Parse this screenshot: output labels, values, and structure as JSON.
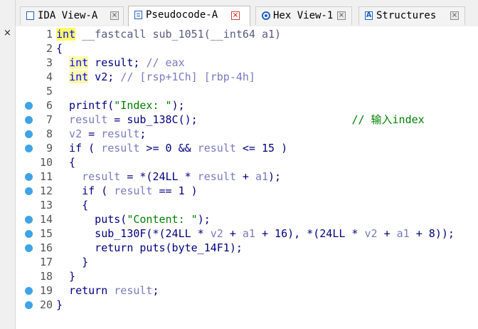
{
  "tabs": [
    {
      "label": "IDA View-A",
      "icon": "ida-view-icon"
    },
    {
      "label": "Pseudocode-A",
      "icon": "pseudocode-icon"
    },
    {
      "label": "Hex View-1",
      "icon": "hex-view-icon"
    },
    {
      "label": "Structures",
      "icon": "structures-icon"
    }
  ],
  "panel_close": "×",
  "tab_close": "×",
  "lines": [
    {
      "n": "1",
      "dot": false,
      "parts": [
        [
          "kwhl",
          "int"
        ],
        [
          "gry",
          " __fastcall sub_1051(__int64 a1)"
        ]
      ]
    },
    {
      "n": "2",
      "dot": false,
      "parts": [
        [
          "plain",
          "{"
        ]
      ]
    },
    {
      "n": "3",
      "dot": false,
      "parts": [
        [
          "plain",
          "  "
        ],
        [
          "kwhl2",
          "int"
        ],
        [
          "plain",
          " result; "
        ],
        [
          "var",
          "// eax"
        ]
      ]
    },
    {
      "n": "4",
      "dot": false,
      "parts": [
        [
          "plain",
          "  "
        ],
        [
          "kwhl2",
          "int"
        ],
        [
          "plain",
          " v2; "
        ],
        [
          "var",
          "// [rsp+1Ch] [rbp-4h]"
        ]
      ]
    },
    {
      "n": "5",
      "dot": false,
      "parts": []
    },
    {
      "n": "6",
      "dot": true,
      "parts": [
        [
          "plain",
          "  printf("
        ],
        [
          "str",
          "\"Index: \""
        ],
        [
          "plain",
          ");"
        ]
      ]
    },
    {
      "n": "7",
      "dot": true,
      "parts": [
        [
          "var",
          "  result"
        ],
        [
          "plain",
          " = sub_138C();"
        ],
        [
          "plain",
          "                        "
        ],
        [
          "cmt",
          "// 输入index"
        ]
      ]
    },
    {
      "n": "8",
      "dot": true,
      "parts": [
        [
          "var",
          "  v2"
        ],
        [
          "plain",
          " = "
        ],
        [
          "var",
          "result"
        ],
        [
          "plain",
          ";"
        ]
      ]
    },
    {
      "n": "9",
      "dot": true,
      "parts": [
        [
          "plain",
          "  if ( "
        ],
        [
          "var",
          "result"
        ],
        [
          "plain",
          " >= 0 && "
        ],
        [
          "var",
          "result"
        ],
        [
          "plain",
          " <= 15 )"
        ]
      ]
    },
    {
      "n": "10",
      "dot": false,
      "parts": [
        [
          "plain",
          "  {"
        ]
      ]
    },
    {
      "n": "11",
      "dot": true,
      "parts": [
        [
          "var",
          "    result"
        ],
        [
          "plain",
          " = *(24LL * "
        ],
        [
          "var",
          "result"
        ],
        [
          "plain",
          " + "
        ],
        [
          "var",
          "a1"
        ],
        [
          "plain",
          ");"
        ]
      ]
    },
    {
      "n": "12",
      "dot": true,
      "parts": [
        [
          "plain",
          "    if ( "
        ],
        [
          "var",
          "result"
        ],
        [
          "plain",
          " == 1 )"
        ]
      ]
    },
    {
      "n": "13",
      "dot": false,
      "parts": [
        [
          "plain",
          "    {"
        ]
      ]
    },
    {
      "n": "14",
      "dot": true,
      "parts": [
        [
          "plain",
          "      puts("
        ],
        [
          "str",
          "\"Content: \""
        ],
        [
          "plain",
          ");"
        ]
      ]
    },
    {
      "n": "15",
      "dot": true,
      "parts": [
        [
          "plain",
          "      sub_130F(*(24LL * "
        ],
        [
          "var",
          "v2"
        ],
        [
          "plain",
          " + "
        ],
        [
          "var",
          "a1"
        ],
        [
          "plain",
          " + 16), *(24LL * "
        ],
        [
          "var",
          "v2"
        ],
        [
          "plain",
          " + "
        ],
        [
          "var",
          "a1"
        ],
        [
          "plain",
          " + 8));"
        ]
      ]
    },
    {
      "n": "16",
      "dot": true,
      "parts": [
        [
          "plain",
          "      return puts(byte_14F1);"
        ]
      ]
    },
    {
      "n": "17",
      "dot": false,
      "parts": [
        [
          "plain",
          "    }"
        ]
      ]
    },
    {
      "n": "18",
      "dot": false,
      "parts": [
        [
          "plain",
          "  }"
        ]
      ]
    },
    {
      "n": "19",
      "dot": true,
      "parts": [
        [
          "plain",
          "  return "
        ],
        [
          "var",
          "result"
        ],
        [
          "plain",
          ";"
        ]
      ]
    },
    {
      "n": "20",
      "dot": true,
      "parts": [
        [
          "plain",
          "}"
        ]
      ]
    }
  ]
}
